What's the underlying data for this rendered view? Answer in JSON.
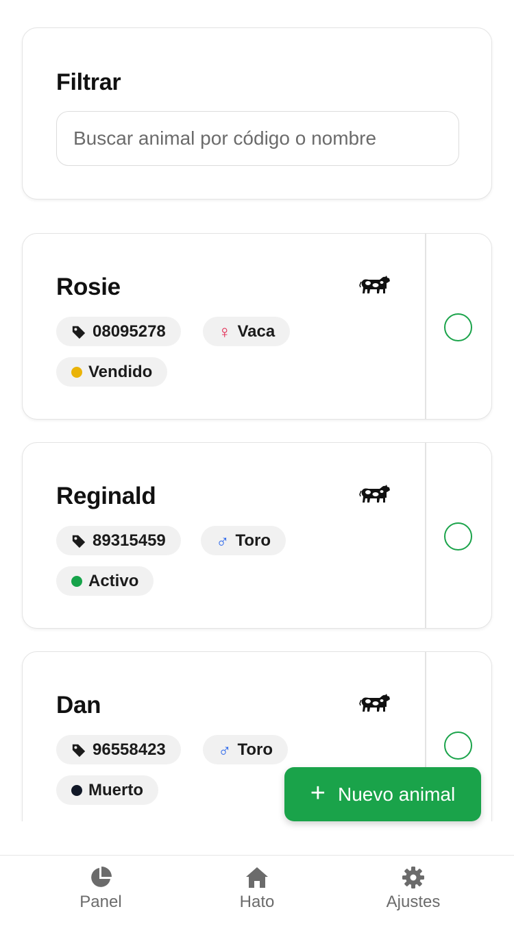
{
  "filter": {
    "title": "Filtrar",
    "search_placeholder": "Buscar animal por código o nombre",
    "search_value": ""
  },
  "animals": [
    {
      "name": "Rosie",
      "tag": "08095278",
      "sex_symbol": "♀",
      "sex_label": "Vaca",
      "status_label": "Vendido",
      "status_color": "#eab308",
      "sex_color": "#e11d48"
    },
    {
      "name": "Reginald",
      "tag": "89315459",
      "sex_symbol": "♂",
      "sex_label": "Toro",
      "status_label": "Activo",
      "status_color": "#16a34a",
      "sex_color": "#2563eb"
    },
    {
      "name": "Dan",
      "tag": "96558423",
      "sex_symbol": "♂",
      "sex_label": "Toro",
      "status_label": "Muerto",
      "status_color": "#111827",
      "sex_color": "#2563eb"
    }
  ],
  "fab": {
    "plus": "+",
    "label": "Nuevo animal"
  },
  "nav": {
    "items": [
      {
        "label": "Panel",
        "icon": "pie-chart-icon"
      },
      {
        "label": "Hato",
        "icon": "home-icon"
      },
      {
        "label": "Ajustes",
        "icon": "gear-icon"
      }
    ]
  },
  "colors": {
    "accent": "#1aa34a",
    "muted_text": "#6b6b6b",
    "chip_bg": "#f1f1f1"
  }
}
